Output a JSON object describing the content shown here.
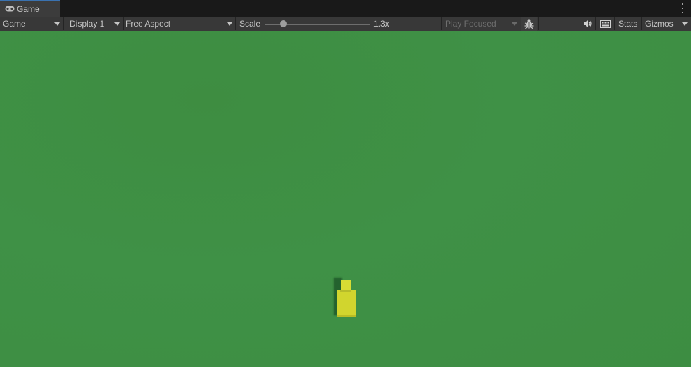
{
  "tab": {
    "label": "Game",
    "icon": "gamepad-icon"
  },
  "toolbar": {
    "view_mode": "Game",
    "display": "Display 1",
    "aspect": "Free Aspect",
    "scale_label": "Scale",
    "scale_value": "1.3x",
    "scale_fraction": 0.17,
    "play_mode": "Play Focused",
    "bug_icon": "bug-icon",
    "audio_icon": "speaker-icon",
    "keyboard_icon": "keyboard-icon",
    "stats": "Stats",
    "gizmos": "Gizmos"
  },
  "colors": {
    "ground": "#3e8f43",
    "player": "#d3d72f",
    "player_shadow": "#1f5a2a",
    "tab_accent": "#3a72b0"
  }
}
